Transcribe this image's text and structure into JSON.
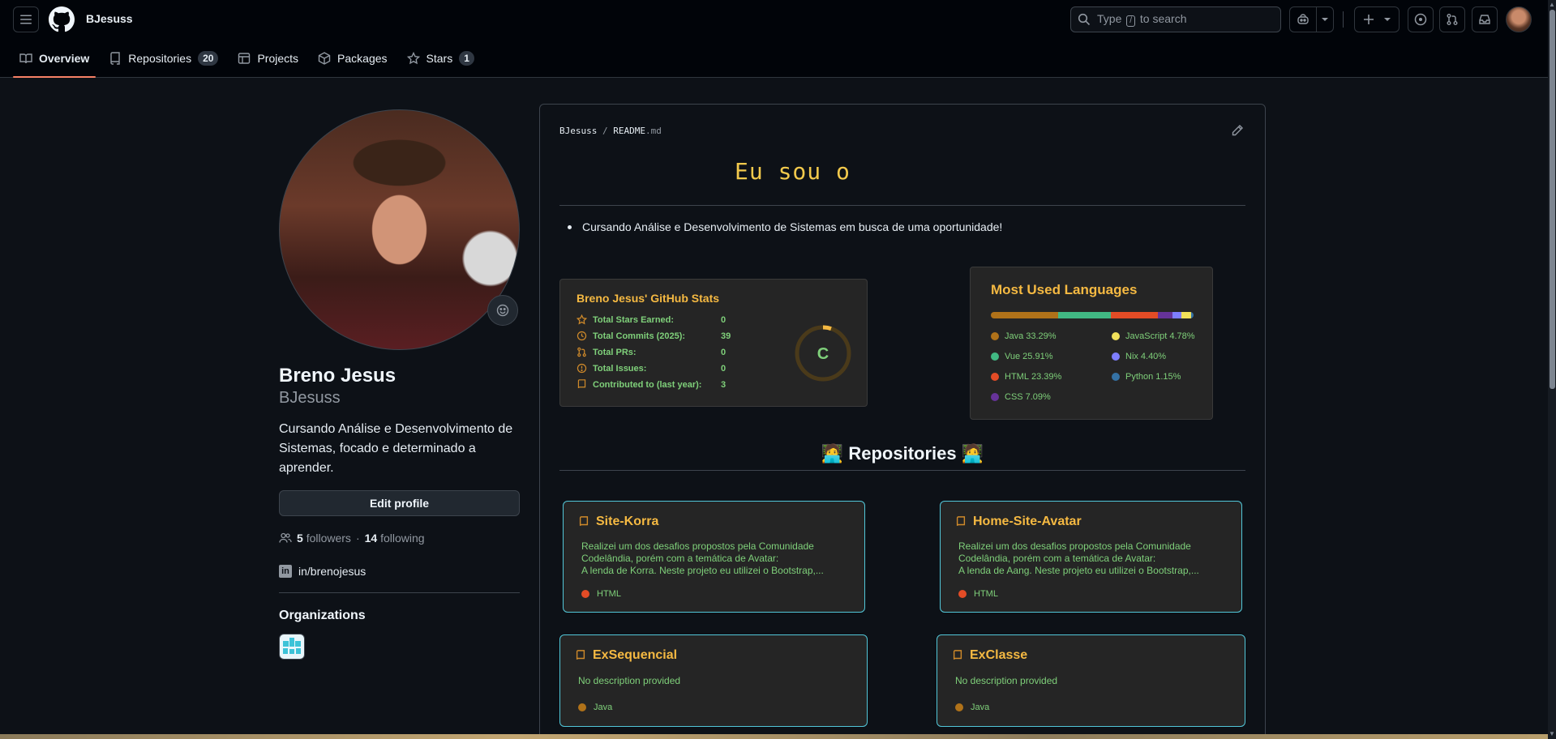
{
  "header": {
    "username": "BJesuss",
    "search_placeholder_prefix": "Type",
    "search_key": "/",
    "search_placeholder_suffix": "to search"
  },
  "tabs": [
    {
      "label": "Overview",
      "icon": "book-icon",
      "selected": true
    },
    {
      "label": "Repositories",
      "icon": "repo-icon",
      "count": "20"
    },
    {
      "label": "Projects",
      "icon": "table-icon"
    },
    {
      "label": "Packages",
      "icon": "package-icon"
    },
    {
      "label": "Stars",
      "icon": "star-icon",
      "count": "1"
    }
  ],
  "profile": {
    "full_name": "Breno Jesus",
    "login": "BJesuss",
    "bio": "Cursando Análise e Desenvolvimento de Sistemas, focado e determinado a aprender.",
    "edit_label": "Edit profile",
    "followers_count": "5",
    "followers_label": "followers",
    "following_count": "14",
    "following_label": "following",
    "linkedin": "in/brenojesus",
    "orgs_title": "Organizations"
  },
  "readme": {
    "path_user": "BJesuss",
    "path_sep": "/",
    "path_file": "README",
    "path_ext": ".md",
    "typing_text": "Eu sou o",
    "bullet": "Cursando Análise e Desenvolvimento de Sistemas em busca de uma oportunidade!",
    "repos_heading": "🧑‍💻 Repositories 🧑‍💻"
  },
  "stats": {
    "title": "Breno Jesus' GitHub Stats",
    "rows": [
      {
        "label": "Total Stars Earned:",
        "value": "0",
        "icon": "star-icon"
      },
      {
        "label": "Total Commits (2025):",
        "value": "39",
        "icon": "history-icon"
      },
      {
        "label": "Total PRs:",
        "value": "0",
        "icon": "pull-request-icon"
      },
      {
        "label": "Total Issues:",
        "value": "0",
        "icon": "issue-icon"
      },
      {
        "label": "Contributed to (last year):",
        "value": "3",
        "icon": "repo-icon"
      }
    ],
    "grade": "C"
  },
  "languages": {
    "title": "Most Used Languages",
    "items": [
      {
        "name": "Java",
        "pct": "33.29%",
        "value": 33.29,
        "color": "#b07219"
      },
      {
        "name": "JavaScript",
        "pct": "4.78%",
        "value": 4.78,
        "color": "#f1e05a"
      },
      {
        "name": "Vue",
        "pct": "25.91%",
        "value": 25.91,
        "color": "#41b883"
      },
      {
        "name": "Nix",
        "pct": "4.40%",
        "value": 4.4,
        "color": "#7e7eff"
      },
      {
        "name": "HTML",
        "pct": "23.39%",
        "value": 23.39,
        "color": "#e34c26"
      },
      {
        "name": "Python",
        "pct": "1.15%",
        "value": 1.15,
        "color": "#3572A5"
      },
      {
        "name": "CSS",
        "pct": "7.09%",
        "value": 7.09,
        "color": "#663399"
      }
    ]
  },
  "repos": [
    {
      "name": "Site-Korra",
      "desc": "Realizei um dos desafios propostos pela Comunidade\nCodelândia, porém com a temática de Avatar:\nA lenda de Korra. Neste projeto eu utilizei o Bootstrap,...",
      "lang": "HTML",
      "lang_color": "#e34c26"
    },
    {
      "name": "Home-Site-Avatar",
      "desc": "Realizei um dos desafios propostos pela Comunidade\nCodelândia, porém com a temática de Avatar:\nA lenda de Aang. Neste projeto eu utilizei o Bootstrap,...",
      "lang": "HTML",
      "lang_color": "#e34c26"
    },
    {
      "name": "ExSequencial",
      "desc": "No description provided",
      "lang": "Java",
      "lang_color": "#b07219"
    },
    {
      "name": "ExClasse",
      "desc": "No description provided",
      "lang": "Java",
      "lang_color": "#b07219"
    }
  ]
}
